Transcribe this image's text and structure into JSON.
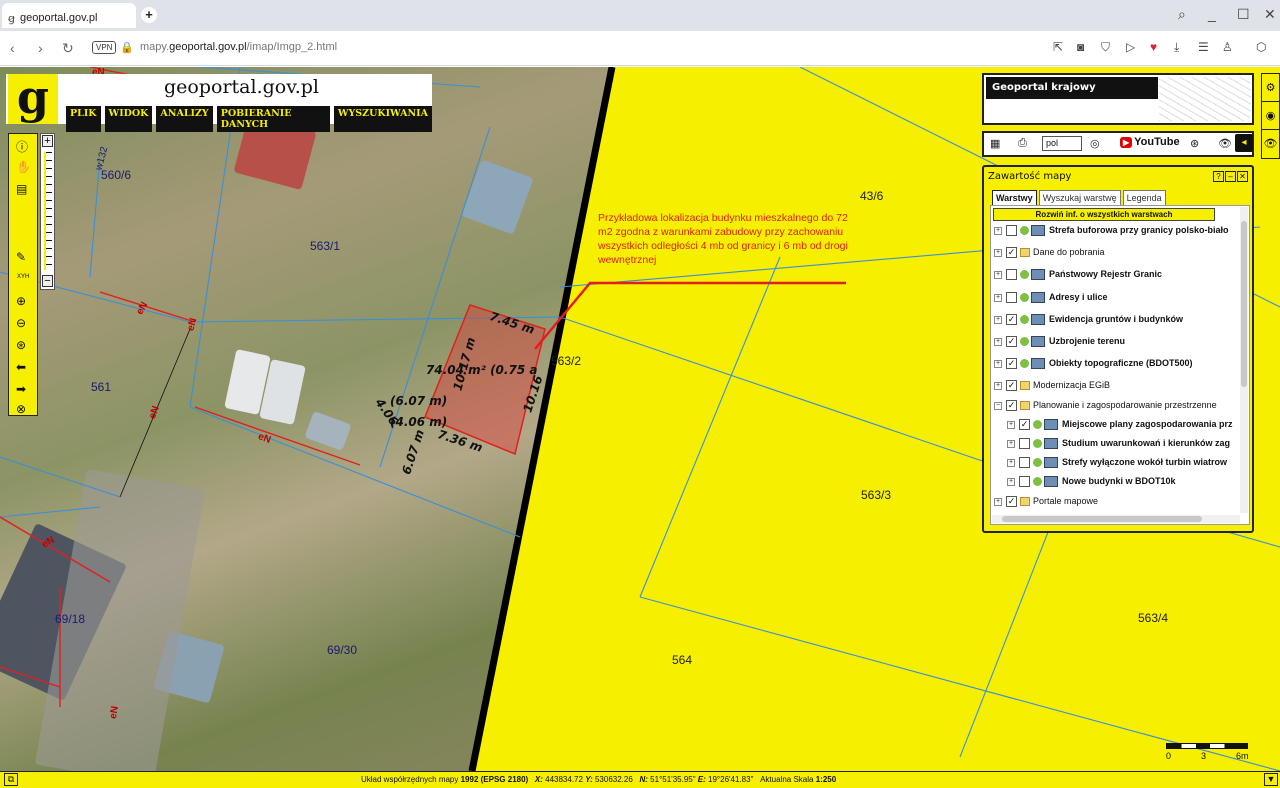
{
  "browser": {
    "tab_title": "geoportal.gov.pl",
    "new_tab": "+",
    "url_prefix": "mapy.",
    "url_domain": "geoportal.gov.pl",
    "url_path": "/imap/Imgp_2.html",
    "vpn_label": "VPN"
  },
  "app": {
    "logo_letter": "g",
    "title": "geoportal.gov.pl",
    "menu": [
      "PLIK",
      "WIDOK",
      "ANALIZY",
      "POBIERANIE DANYCH",
      "WYSZUKIWANIA"
    ]
  },
  "map": {
    "parcels": {
      "p560_6": "560/6",
      "p563_1": "563/1",
      "p561": "561",
      "p69_18": "69/18",
      "p69_30": "69/30",
      "p43_6": "43/6",
      "p563_2": "563/2",
      "p563_3": "563/3",
      "p563_4": "563/4",
      "p564": "564",
      "w132": "w132"
    },
    "en_label": "eN",
    "annotation": "Przykładowa lokalizacja budynku mieszkalnego do 72 m2  zgodna z warunkami zabudowy przy zachowaniu wszystkich odległości 4 mb od granicy i 6 mb od drogi wewnętrznej",
    "measurements": {
      "m1": "7.45 m",
      "m2": "74.04 m² (0.75 a",
      "m3": "10.17 m",
      "m4": "(6.07 m)",
      "m5": "(4.06 m)",
      "m6": "7.36 m",
      "m7": "4.06",
      "m8": "6.07 m",
      "m9": "10.16"
    },
    "xyh": "XYH"
  },
  "right": {
    "geoportal_krajowy": "Geoportal krajowy",
    "lang": "pol",
    "youtube": "YouTube",
    "layers_title": "Zawartość mapy",
    "tabs": [
      "Warstwy",
      "Wyszukaj warstwę",
      "Legenda"
    ],
    "expand_all": "Rozwiń inf. o wszystkich warstwach",
    "layers": [
      {
        "label": "Strefa buforowa przy granicy polsko-biało",
        "bold": true,
        "checked": false,
        "type": "wms"
      },
      {
        "label": "Dane do pobrania",
        "bold": false,
        "checked": true,
        "type": "folder"
      },
      {
        "label": "Państwowy Rejestr Granic",
        "bold": true,
        "checked": false,
        "type": "wms"
      },
      {
        "label": "Adresy i ulice",
        "bold": true,
        "checked": false,
        "type": "wms"
      },
      {
        "label": "Ewidencja gruntów i budynków",
        "bold": true,
        "checked": true,
        "type": "wms"
      },
      {
        "label": "Uzbrojenie terenu",
        "bold": true,
        "checked": true,
        "type": "wms"
      },
      {
        "label": "Obiekty topograficzne (BDOT500)",
        "bold": true,
        "checked": true,
        "type": "wms"
      },
      {
        "label": "Modernizacja EGiB",
        "bold": false,
        "checked": true,
        "type": "folder"
      },
      {
        "label": "Planowanie i zagospodarowanie przestrzenne",
        "bold": false,
        "checked": true,
        "type": "folder"
      },
      {
        "label": "Miejscowe plany zagospodarowania prz",
        "bold": true,
        "checked": true,
        "type": "wms",
        "indent": true
      },
      {
        "label": "Studium uwarunkowań i kierunków zag",
        "bold": true,
        "checked": false,
        "type": "wms",
        "indent": true
      },
      {
        "label": "Strefy wyłączone wokół turbin wiatrow",
        "bold": true,
        "checked": false,
        "type": "wms",
        "indent": true
      },
      {
        "label": "Nowe budynki w BDOT10k",
        "bold": true,
        "checked": false,
        "type": "wms",
        "indent": true
      },
      {
        "label": "Portale mapowe",
        "bold": false,
        "checked": true,
        "type": "folder"
      }
    ]
  },
  "scale": {
    "l0": "0",
    "l3": "3",
    "l6": "6m"
  },
  "status": {
    "prefix": "Układ współrzędnych mapy",
    "system": "1992 (EPSG 2180)",
    "x_label": "X:",
    "x_val": "443834.72",
    "y_label": "Y:",
    "y_val": "530632.26",
    "n_label": "N:",
    "n_val": "51°51'35.95\"",
    "e_label": "E:",
    "e_val": "19°26'41.83\"",
    "scale_label": "Aktualna Skala",
    "scale_val": "1:250"
  },
  "colors": {
    "accent": "#f6ef00",
    "red": "#e0201e"
  }
}
